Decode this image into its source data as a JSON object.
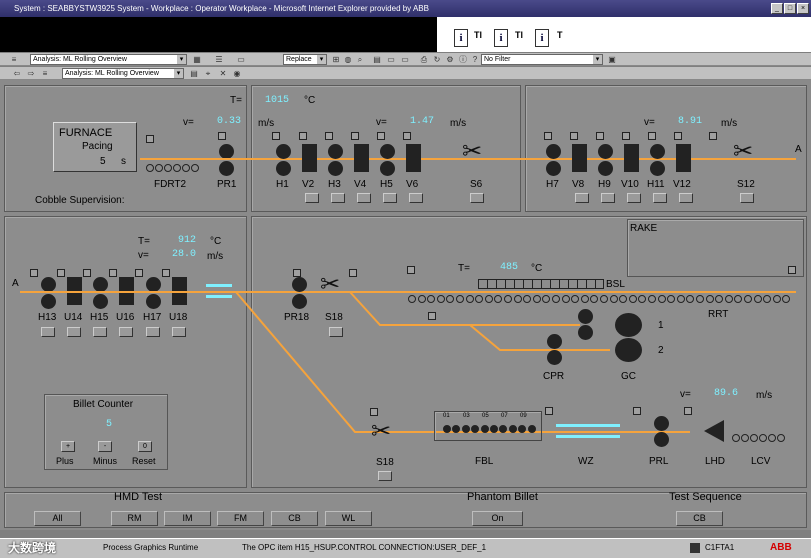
{
  "window": {
    "title": "System : SEABBYSTW3925 System - Workplace : Operator Workplace - Microsoft Internet Explorer provided by ABB"
  },
  "infobar": {
    "t1": "Tl",
    "t2": "Tl",
    "t3": "T"
  },
  "toolbar1": {
    "analysis": "Analysis: ML Rolling Overview",
    "replace": "Replace",
    "filter": "No Filter"
  },
  "toolbar2": {
    "analysis": "Analysis: ML Rolling Overview"
  },
  "top_left": {
    "furnace_title": "FURNACE",
    "furnace_sub": "Pacing",
    "furnace_value": "5",
    "furnace_unit": "s",
    "t_label": "T=",
    "t_value": "1015",
    "t_unit": "°C",
    "v_label": "v=",
    "v_value": "0.33",
    "v_unit": "m/s",
    "fdrt": "FDRT2",
    "pr1": "PR1",
    "cobble": "Cobble Supervision:"
  },
  "top_mid": {
    "v_label": "v=",
    "v_value": "1.47",
    "v_unit": "m/s",
    "labels": [
      "H1",
      "V2",
      "H3",
      "V4",
      "H5",
      "V6"
    ],
    "s6": "S6"
  },
  "top_right": {
    "v_label": "v=",
    "v_value": "8.91",
    "v_unit": "m/s",
    "labels": [
      "H7",
      "V8",
      "H9",
      "V10",
      "H11",
      "V12"
    ],
    "s12": "S12",
    "a_label": "A"
  },
  "mid_left": {
    "t_label": "T=",
    "t_value": "912",
    "t_unit": "°C",
    "v_label": "v=",
    "v_value": "28.0",
    "v_unit": "m/s",
    "a_label": "A",
    "labels": [
      "H13",
      "U14",
      "H15",
      "U16",
      "H17",
      "U18"
    ]
  },
  "billet": {
    "title": "Billet Counter",
    "value": "5",
    "plus_sym": "+",
    "minus_sym": "-",
    "reset_sym": "0",
    "plus": "Plus",
    "minus": "Minus",
    "reset": "Reset"
  },
  "mid_right": {
    "rake": "RAKE",
    "t_label": "T=",
    "t_value": "485",
    "t_unit": "°C",
    "bsl": "BSL",
    "pr18": "PR18",
    "s18a": "S18",
    "rrt": "RRT",
    "n1": "1",
    "n2": "2",
    "cpr": "CPR",
    "gc": "GC",
    "v_label": "v=",
    "v_value": "89.6",
    "v_unit": "m/s",
    "s18b": "S18",
    "fbl": "FBL",
    "wz": "WZ",
    "prl": "PRL",
    "lhd": "LHD",
    "lcv": "LCV",
    "fbl_nums": [
      "01",
      "03",
      "05",
      "07",
      "09"
    ]
  },
  "bottom": {
    "hmd": "HMD Test",
    "phantom": "Phantom Billet",
    "testseq": "Test Sequence",
    "buttons": [
      "All",
      "RM",
      "IM",
      "FM",
      "CB",
      "WL"
    ],
    "on": "On",
    "cb": "CB"
  },
  "status": {
    "left": "Process Graphics Runtime",
    "mid": "The OPC item H15_HSUP.CONTROL CONNECTION:USER_DEF_1",
    "right": "C1FTA1",
    "brand": "ABB",
    "watermark": "大数跨境"
  },
  "colors": {
    "line": "#f5a33c",
    "value": "#7ff0ff",
    "brand": "#d40000"
  }
}
